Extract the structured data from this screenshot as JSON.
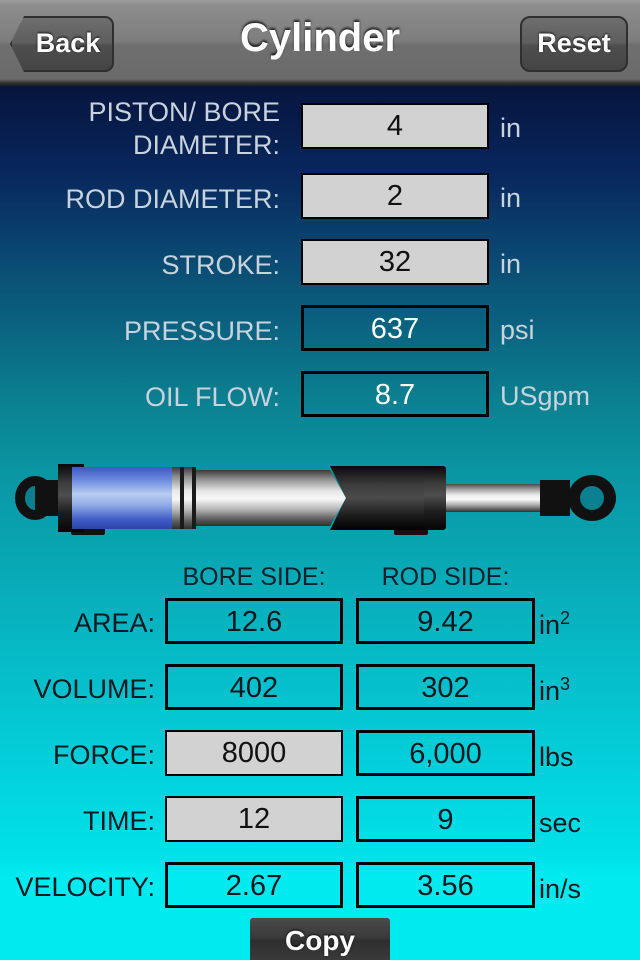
{
  "navbar": {
    "back_label": "Back",
    "title": "Cylinder",
    "reset_label": "Reset"
  },
  "inputs": [
    {
      "label": "PISTON/ BORE DIAMETER:",
      "value": "4",
      "unit": "in",
      "editable": true
    },
    {
      "label": "ROD DIAMETER:",
      "value": "2",
      "unit": "in",
      "editable": true
    },
    {
      "label": "STROKE:",
      "value": "32",
      "unit": "in",
      "editable": true
    },
    {
      "label": "PRESSURE:",
      "value": "637",
      "unit": "psi",
      "editable": false
    },
    {
      "label": "OIL FLOW:",
      "value": "8.7",
      "unit": "USgpm",
      "editable": false
    }
  ],
  "results": {
    "column_headers": {
      "bore": "BORE SIDE:",
      "rod": "ROD SIDE:"
    },
    "rows": [
      {
        "label": "AREA:",
        "bore": "12.6",
        "rod": "9.42",
        "unit": "in",
        "unit_sup": "2",
        "bore_editable": false,
        "rod_editable": false
      },
      {
        "label": "VOLUME:",
        "bore": "402",
        "rod": "302",
        "unit": "in",
        "unit_sup": "3",
        "bore_editable": false,
        "rod_editable": false
      },
      {
        "label": "FORCE:",
        "bore": "8000",
        "rod": "6,000",
        "unit": "lbs",
        "unit_sup": "",
        "bore_editable": true,
        "rod_editable": false
      },
      {
        "label": "TIME:",
        "bore": "12",
        "rod": "9",
        "unit": "sec",
        "unit_sup": "",
        "bore_editable": true,
        "rod_editable": false
      },
      {
        "label": "VELOCITY:",
        "bore": "2.67",
        "rod": "3.56",
        "unit": "in/s",
        "unit_sup": "",
        "bore_editable": false,
        "rod_editable": false
      }
    ]
  },
  "footer": {
    "copy_label": "Copy"
  },
  "icons": {
    "back_chevron": "back-chevron-icon",
    "cylinder": "hydraulic-cylinder-diagram"
  },
  "colors": {
    "background_top": "#04042a",
    "background_bottom": "#00eaf0",
    "navbar_gray": "#6f6f6f",
    "editable_field": "#d2d2d2",
    "piston_blue": "#4a6fd8"
  }
}
